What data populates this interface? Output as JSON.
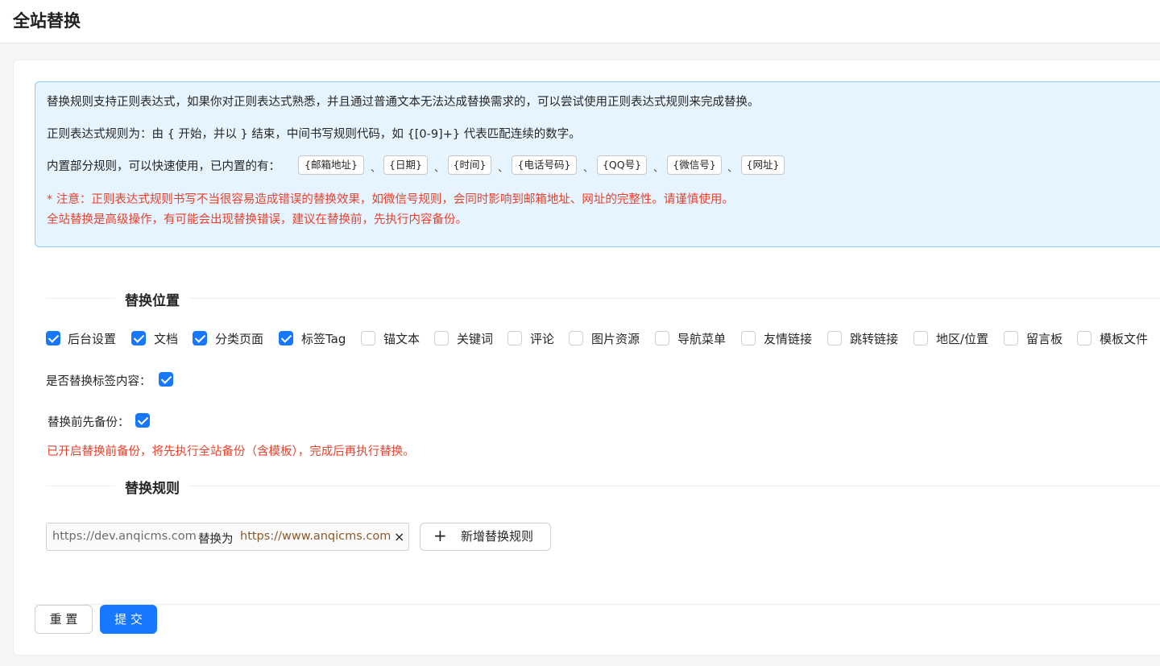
{
  "page": {
    "title": "全站替换"
  },
  "alert": {
    "line1": "替换规则支持正则表达式，如果你对正则表达式熟悉，并且通过普通文本无法达成替换需求的，可以尝试使用正则表达式规则来完成替换。",
    "line2": "正则表达式规则为：由 { 开始，并以 } 结束，中间书写规则代码，如 {[0-9]+} 代表匹配连续的数字。",
    "line3_prefix": "内置部分规则，可以快速使用，已内置的有：",
    "separator": "、",
    "tags": [
      "{邮箱地址}",
      "{日期}",
      "{时间}",
      "{电话号码}",
      "{QQ号}",
      "{微信号}",
      "{网址}"
    ],
    "warning1": "* 注意：正则表达式规则书写不当很容易造成错误的替换效果，如微信号规则，会同时影响到邮箱地址、网址的完整性。请谨慎使用。",
    "warning2": "全站替换是高级操作，有可能会出现替换错误，建议在替换前，先执行内容备份。"
  },
  "position_section": {
    "title": "替换位置",
    "options": [
      {
        "label": "后台设置",
        "checked": true
      },
      {
        "label": "文档",
        "checked": true
      },
      {
        "label": "分类页面",
        "checked": true
      },
      {
        "label": "标签Tag",
        "checked": true
      },
      {
        "label": "锚文本",
        "checked": false
      },
      {
        "label": "关键词",
        "checked": false
      },
      {
        "label": "评论",
        "checked": false
      },
      {
        "label": "图片资源",
        "checked": false
      },
      {
        "label": "导航菜单",
        "checked": false
      },
      {
        "label": "友情链接",
        "checked": false
      },
      {
        "label": "跳转链接",
        "checked": false
      },
      {
        "label": "地区/位置",
        "checked": false
      },
      {
        "label": "留言板",
        "checked": false
      },
      {
        "label": "模板文件",
        "checked": false
      }
    ],
    "replace_tag_label": "是否替换标签内容：",
    "replace_tag_checked": true,
    "backup_label": "替换前先备份：",
    "backup_checked": true,
    "backup_notice": "已开启替换前备份，将先执行全站备份（含模板），完成后再执行替换。"
  },
  "rules_section": {
    "title": "替换规则",
    "rules": [
      {
        "from": "https://dev.anqicms.com",
        "joiner": "替换为",
        "to": "https://www.anqicms.com",
        "close": "×"
      }
    ],
    "add_icon": "+",
    "add_label": "新增替换规则"
  },
  "actions": {
    "reset": "重 置",
    "submit": "提 交"
  },
  "colors": {
    "primary": "#1677ff",
    "warning": "#e8412b",
    "alert_bg": "#e6f4ff",
    "alert_border": "#91caff"
  }
}
